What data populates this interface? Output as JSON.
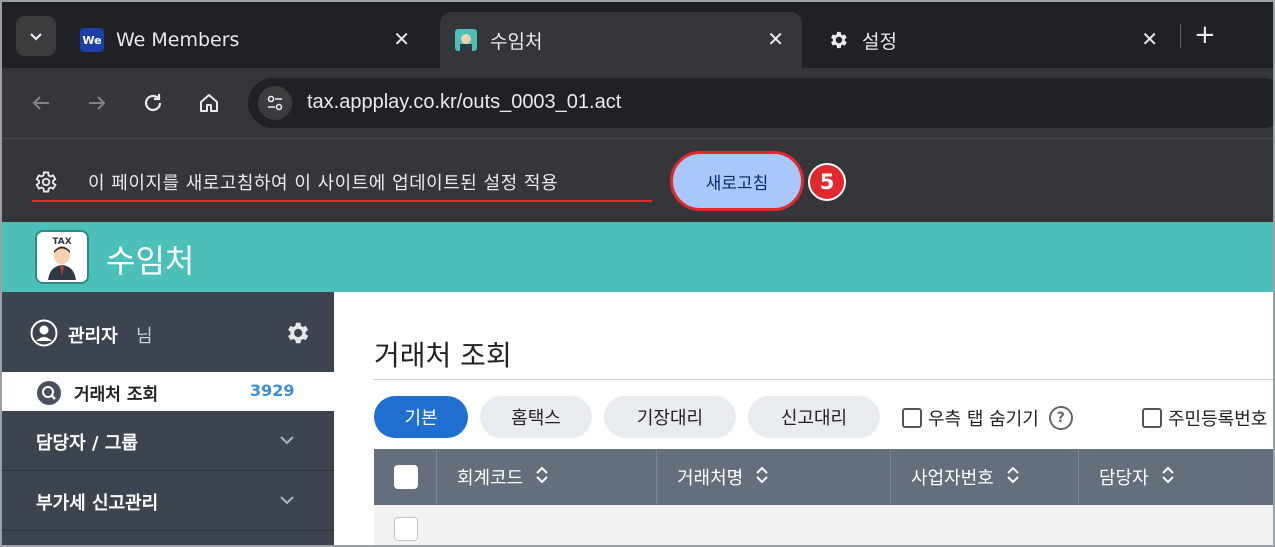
{
  "browser": {
    "tabs": [
      {
        "label": "We Members",
        "favicon_text": "We",
        "active": false
      },
      {
        "label": "수임처",
        "active": true
      },
      {
        "label": "설정",
        "active": false
      }
    ],
    "url": "tax.appplay.co.kr/outs_0003_01.act"
  },
  "infobar": {
    "message": "이 페이지를 새로고침하여 이 사이트에 업데이트된 설정 적용",
    "refresh_label": "새로고침",
    "step_badge": "5",
    "highlight_color": "#e0282d"
  },
  "app": {
    "title": "수임처",
    "logo_text": "TAX",
    "accent": "#4bc0b9"
  },
  "sidebar": {
    "user_name": "관리자",
    "user_suffix": "님",
    "active_item": {
      "label": "거래처 조회",
      "count": "3929"
    },
    "items": [
      {
        "label": "담당자 / 그룹"
      },
      {
        "label": "부가세 신고관리"
      }
    ]
  },
  "main": {
    "title": "거래처 조회",
    "filter_tabs": [
      "기본",
      "홈택스",
      "기장대리",
      "신고대리"
    ],
    "options": [
      {
        "label": "우측 탭 숨기기",
        "has_help": true,
        "help_glyph": "?"
      },
      {
        "label": "주민등록번호"
      }
    ],
    "columns": [
      "회계코드",
      "거래처명",
      "사업자번호",
      "담당자"
    ]
  }
}
